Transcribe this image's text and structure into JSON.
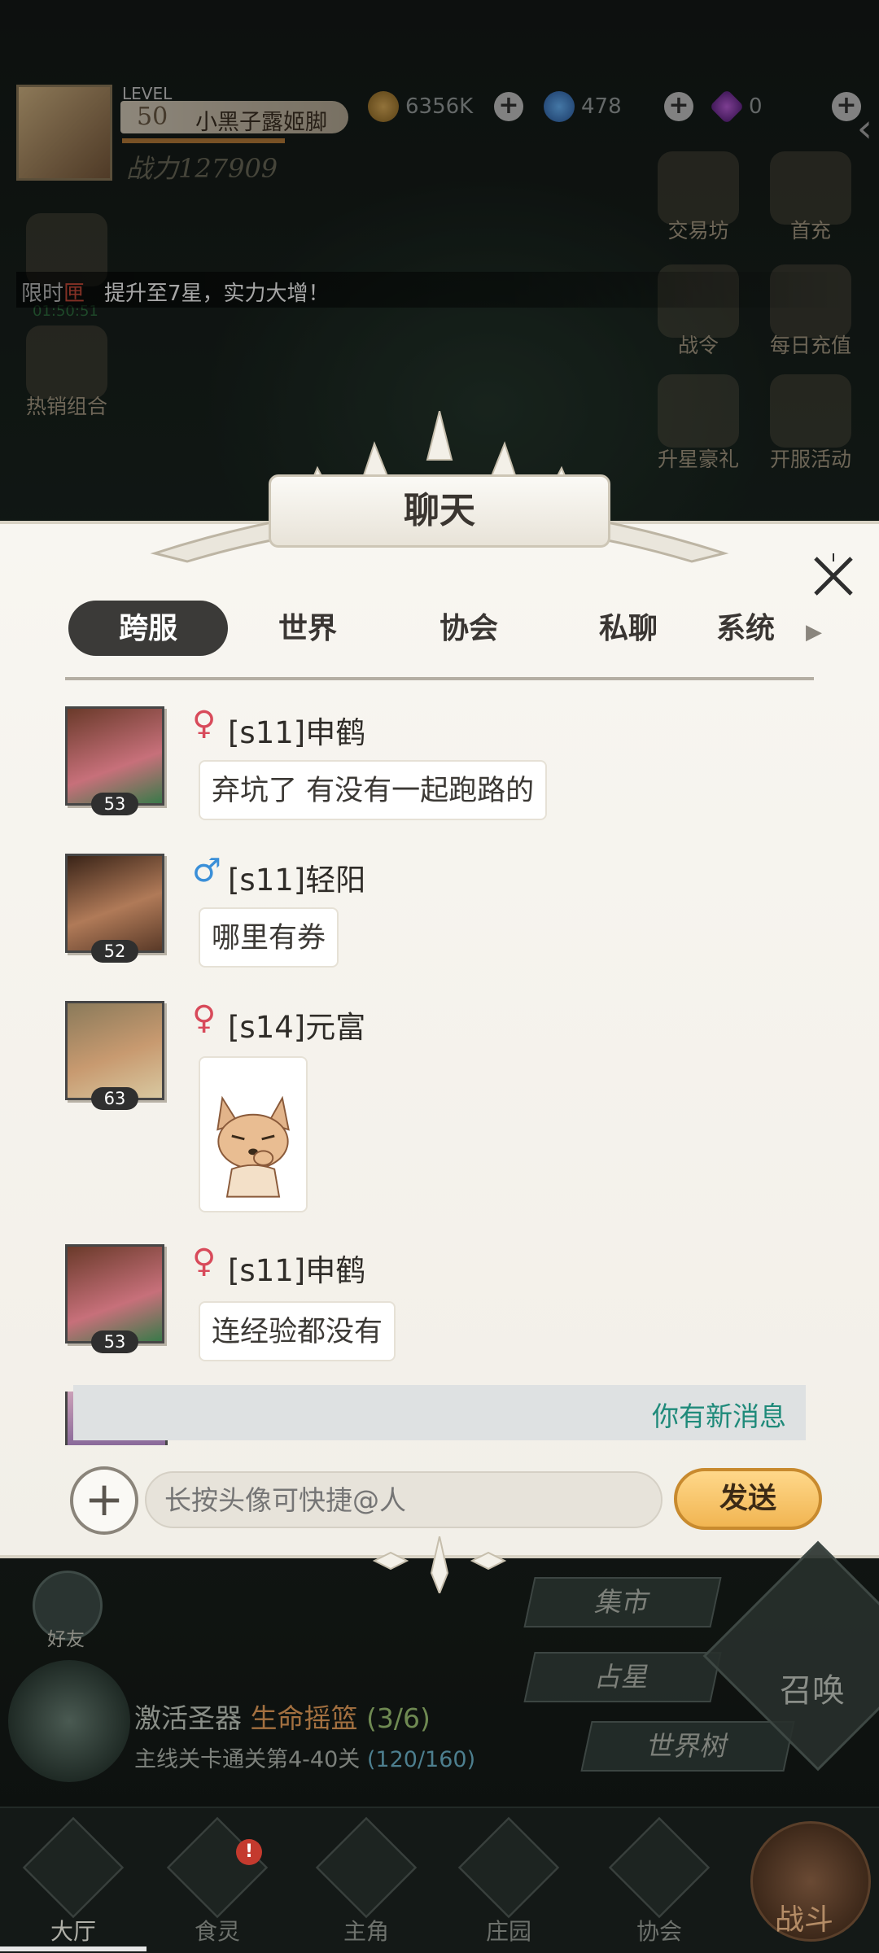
{
  "top_bar": {
    "level_label": "LEVEL",
    "level": "50",
    "player_name": "小黑子露姬脚",
    "combat_power": "战力127909",
    "gold": "6356K",
    "gems": "478",
    "diamonds": "0"
  },
  "side_left": {
    "limited_label": "限时",
    "limited_tag": "匣",
    "timer": "01:50:51",
    "hot_bundle": "热销组合"
  },
  "side_right": {
    "items": [
      "交易坊",
      "首充",
      "战令",
      "每日充值",
      "升星豪礼",
      "开服活动"
    ]
  },
  "marquee": {
    "text": "提升至7星，实力大增！"
  },
  "chat": {
    "title": "聊天",
    "tabs": [
      "跨服",
      "世界",
      "协会",
      "私聊",
      "系统"
    ],
    "active_tab": "跨服",
    "messages": [
      {
        "gender": "♀",
        "name": "[s11]申鹤",
        "level": "53",
        "text": "弃坑了 有没有一起跑路的"
      },
      {
        "gender": "♂",
        "name": "[s11]轻阳",
        "level": "52",
        "text": "哪里有券"
      },
      {
        "gender": "♀",
        "name": "[s14]元富",
        "level": "63",
        "sticker": "fox-sticker"
      },
      {
        "gender": "♀",
        "name": "[s11]申鹤",
        "level": "53",
        "text": "连经验都没有"
      }
    ],
    "new_message_notice": "你有新消息",
    "input_placeholder": "长按头像可快捷@人",
    "send_label": "发送",
    "colors": {
      "female": "#d84a5a",
      "male": "#3a8fd8",
      "active_tab_bg": "#3b3a38"
    }
  },
  "bottom": {
    "friends_label": "好友",
    "market_label": "集市",
    "astrology_label": "占星",
    "world_tree_label": "世界树",
    "summon_label": "召唤",
    "quest1_prefix": "激活圣器",
    "quest1_highlight": "生命摇篮",
    "quest1_count": "(3/6)",
    "quest2_text": "主线关卡通关第4-40关",
    "quest2_count": "(120/160)"
  },
  "nav": {
    "items": [
      "大厅",
      "食灵",
      "主角",
      "庄园",
      "协会"
    ],
    "battle_label": "战斗",
    "badge": "!"
  }
}
